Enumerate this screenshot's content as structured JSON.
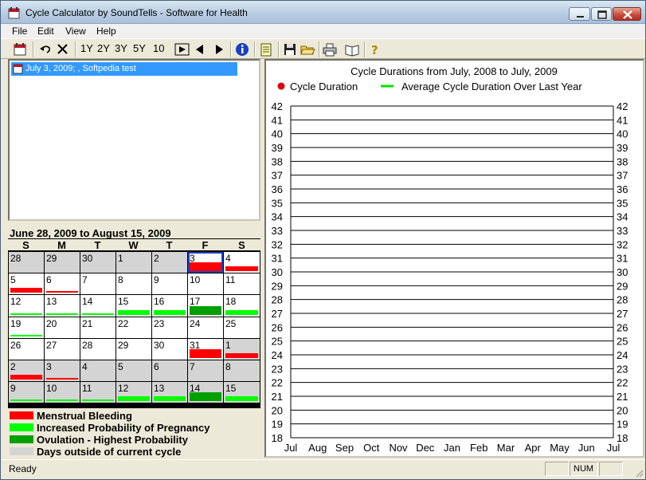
{
  "window": {
    "title": "Cycle Calculator by SoundTells - Software for Health"
  },
  "menu": [
    "File",
    "Edit",
    "View",
    "Help"
  ],
  "toolbar": {
    "range_buttons": [
      "1Y",
      "2Y",
      "3Y",
      "5Y",
      "10"
    ]
  },
  "records": [
    {
      "label": "July 3, 2009; , Softpedia test",
      "selected": true
    }
  ],
  "calendar": {
    "title": "June 28, 2009 to August 15, 2009",
    "weekdays": [
      "S",
      "M",
      "T",
      "W",
      "T",
      "F",
      "S"
    ],
    "weeks": [
      [
        {
          "day": "28",
          "type": "out"
        },
        {
          "day": "29",
          "type": "out"
        },
        {
          "day": "30",
          "type": "out"
        },
        {
          "day": "1",
          "type": "out"
        },
        {
          "day": "2",
          "type": "out"
        },
        {
          "day": "3",
          "type": "menstrual-full",
          "selected": true
        },
        {
          "day": "4",
          "type": "menstrual"
        }
      ],
      [
        {
          "day": "5",
          "type": "menstrual"
        },
        {
          "day": "6",
          "type": "menstrual-thin"
        },
        {
          "day": "7",
          "type": "none"
        },
        {
          "day": "8",
          "type": "none"
        },
        {
          "day": "9",
          "type": "none"
        },
        {
          "day": "10",
          "type": "none"
        },
        {
          "day": "11",
          "type": "none"
        }
      ],
      [
        {
          "day": "12",
          "type": "fertile-thin"
        },
        {
          "day": "13",
          "type": "fertile-thin"
        },
        {
          "day": "14",
          "type": "fertile-thin"
        },
        {
          "day": "15",
          "type": "fertile"
        },
        {
          "day": "16",
          "type": "fertile"
        },
        {
          "day": "17",
          "type": "ovulation"
        },
        {
          "day": "18",
          "type": "fertile"
        }
      ],
      [
        {
          "day": "19",
          "type": "fertile-thin"
        },
        {
          "day": "20",
          "type": "none"
        },
        {
          "day": "21",
          "type": "none"
        },
        {
          "day": "22",
          "type": "none"
        },
        {
          "day": "23",
          "type": "none"
        },
        {
          "day": "24",
          "type": "none"
        },
        {
          "day": "25",
          "type": "none"
        }
      ],
      [
        {
          "day": "26",
          "type": "none"
        },
        {
          "day": "27",
          "type": "none"
        },
        {
          "day": "28",
          "type": "none"
        },
        {
          "day": "29",
          "type": "none"
        },
        {
          "day": "30",
          "type": "none"
        },
        {
          "day": "31",
          "type": "menstrual-full"
        },
        {
          "day": "1",
          "type": "out-menstrual"
        }
      ],
      [
        {
          "day": "2",
          "type": "out-menstrual"
        },
        {
          "day": "3",
          "type": "out-menstrual-thin"
        },
        {
          "day": "4",
          "type": "out"
        },
        {
          "day": "5",
          "type": "out"
        },
        {
          "day": "6",
          "type": "out"
        },
        {
          "day": "7",
          "type": "out"
        },
        {
          "day": "8",
          "type": "out"
        }
      ],
      [
        {
          "day": "9",
          "type": "out-fertile-thin"
        },
        {
          "day": "10",
          "type": "out-fertile-thin"
        },
        {
          "day": "11",
          "type": "out-fertile-thin"
        },
        {
          "day": "12",
          "type": "out-fertile"
        },
        {
          "day": "13",
          "type": "out-fertile"
        },
        {
          "day": "14",
          "type": "out-ovulation"
        },
        {
          "day": "15",
          "type": "out-fertile"
        }
      ]
    ]
  },
  "legend": [
    {
      "label": "Menstrual Bleeding",
      "color": "#ff0000"
    },
    {
      "label": "Increased Probability of Pregnancy",
      "color": "#00ff00"
    },
    {
      "label": "Ovulation - Highest Probability",
      "color": "#00a000"
    },
    {
      "label": "Days outside of current cycle",
      "color": "#d4d4d4"
    }
  ],
  "chart_data": {
    "type": "line",
    "title": "Cycle Durations from July, 2008 to July, 2009",
    "series": [
      {
        "name": "Cycle Duration",
        "color": "#e00000",
        "values": []
      },
      {
        "name": "Average Cycle Duration Over Last Year",
        "color": "#00e000",
        "values": []
      }
    ],
    "categories": [
      "Jul",
      "Aug",
      "Sep",
      "Oct",
      "Nov",
      "Dec",
      "Jan",
      "Feb",
      "Mar",
      "Apr",
      "May",
      "Jun",
      "Jul"
    ],
    "ylim": [
      18,
      42
    ],
    "y_ticks": [
      "42",
      "41",
      "40",
      "39",
      "38",
      "37",
      "36",
      "35",
      "34",
      "33",
      "32",
      "31",
      "30",
      "29",
      "28",
      "27",
      "26",
      "25",
      "24",
      "23",
      "22",
      "21",
      "20",
      "19",
      "18"
    ],
    "grid": true,
    "legend_position": "top"
  },
  "status": {
    "text": "Ready",
    "num": "NUM"
  },
  "colors": {
    "menstrual": "#ff0000",
    "fertile": "#00ff00",
    "ovulation": "#00a000",
    "outside": "#d4d4d4",
    "selected_border": "#2040c0"
  }
}
